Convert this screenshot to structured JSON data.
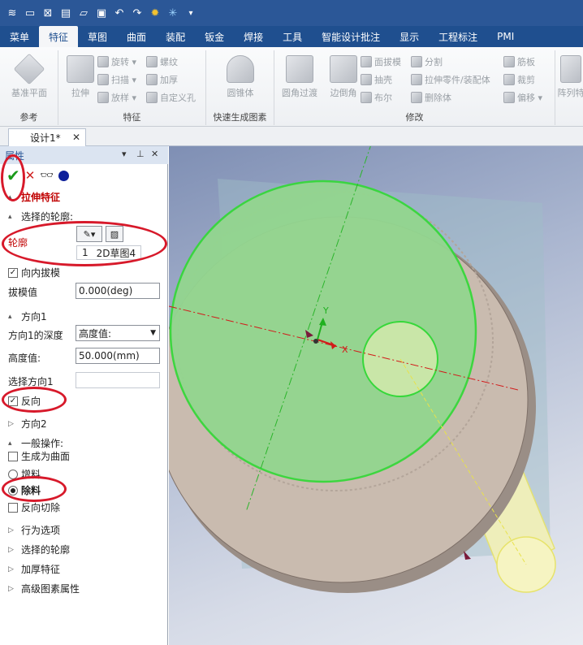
{
  "quick_access": {
    "icons": [
      "app-icon",
      "new-file-icon",
      "close-file-icon",
      "print-icon",
      "open-icon",
      "save-icon",
      "undo-icon",
      "redo-icon",
      "settings-icon",
      "magic-icon",
      "dropdown-icon"
    ]
  },
  "menubar": {
    "items": [
      "菜单",
      "特征",
      "草图",
      "曲面",
      "装配",
      "钣金",
      "焊接",
      "工具",
      "智能设计批注",
      "显示",
      "工程标注",
      "PMI"
    ],
    "active": "特征"
  },
  "ribbon": {
    "groups": {
      "reference": {
        "label": "参考",
        "base_plane": "基准平面"
      },
      "feature": {
        "label": "特征",
        "extrude": "拉伸",
        "revolve": "旋转",
        "sweep": "扫描",
        "loft": "放样",
        "thread": "螺纹",
        "thicken": "加厚",
        "custom_hole": "自定义孔"
      },
      "quick": {
        "label": "快速生成图素",
        "cone": "圆锥体"
      },
      "modify": {
        "label": "修改",
        "fillet": "圆角过渡",
        "chamfer": "边倒角",
        "draft": "面拔模",
        "shell": "抽壳",
        "boolean": "布尔",
        "split": "分割",
        "extrude_part": "拉伸零件/装配体",
        "delete_body": "删除体",
        "sheet": "筋板",
        "trim": "裁剪",
        "offset": "偏移",
        "pattern": "阵列特"
      }
    }
  },
  "doc_tab": {
    "label": "设计1*",
    "close": "✕"
  },
  "panel": {
    "header": "属性",
    "feature_title": "拉伸特征",
    "profile_section": "选择的轮廓:",
    "profile_label": "轮廓",
    "profile_row_index": "1",
    "profile_row_value": "2D草图4",
    "inward_draft": "向内拔模",
    "draft_label": "拔模值",
    "draft_value": "0.000(deg)",
    "direction1_section": "方向1",
    "depth_label": "方向1的深度",
    "depth_value": "高度值:",
    "height_label": "高度值:",
    "height_value": "50.000(mm)",
    "select_dir_label": "选择方向1",
    "reverse_label": "反向",
    "direction2_section": "方向2",
    "general_section": "一般操作:",
    "gen_surface": "生成为曲面",
    "add_material": "增料",
    "remove_material": "除料",
    "reverse_cut": "反向切除",
    "collapsed": [
      "行为选项",
      "选择的轮廓",
      "加厚特征",
      "高级图素属性"
    ]
  },
  "viewport": {
    "axis_x_label": "X",
    "axis_y_label": "Y"
  },
  "colors": {
    "title_bar": "#2b5797",
    "annotation_red": "#d7192a",
    "sketch_green": "#2fd02f",
    "ring_tan": "#c9bbaf"
  }
}
